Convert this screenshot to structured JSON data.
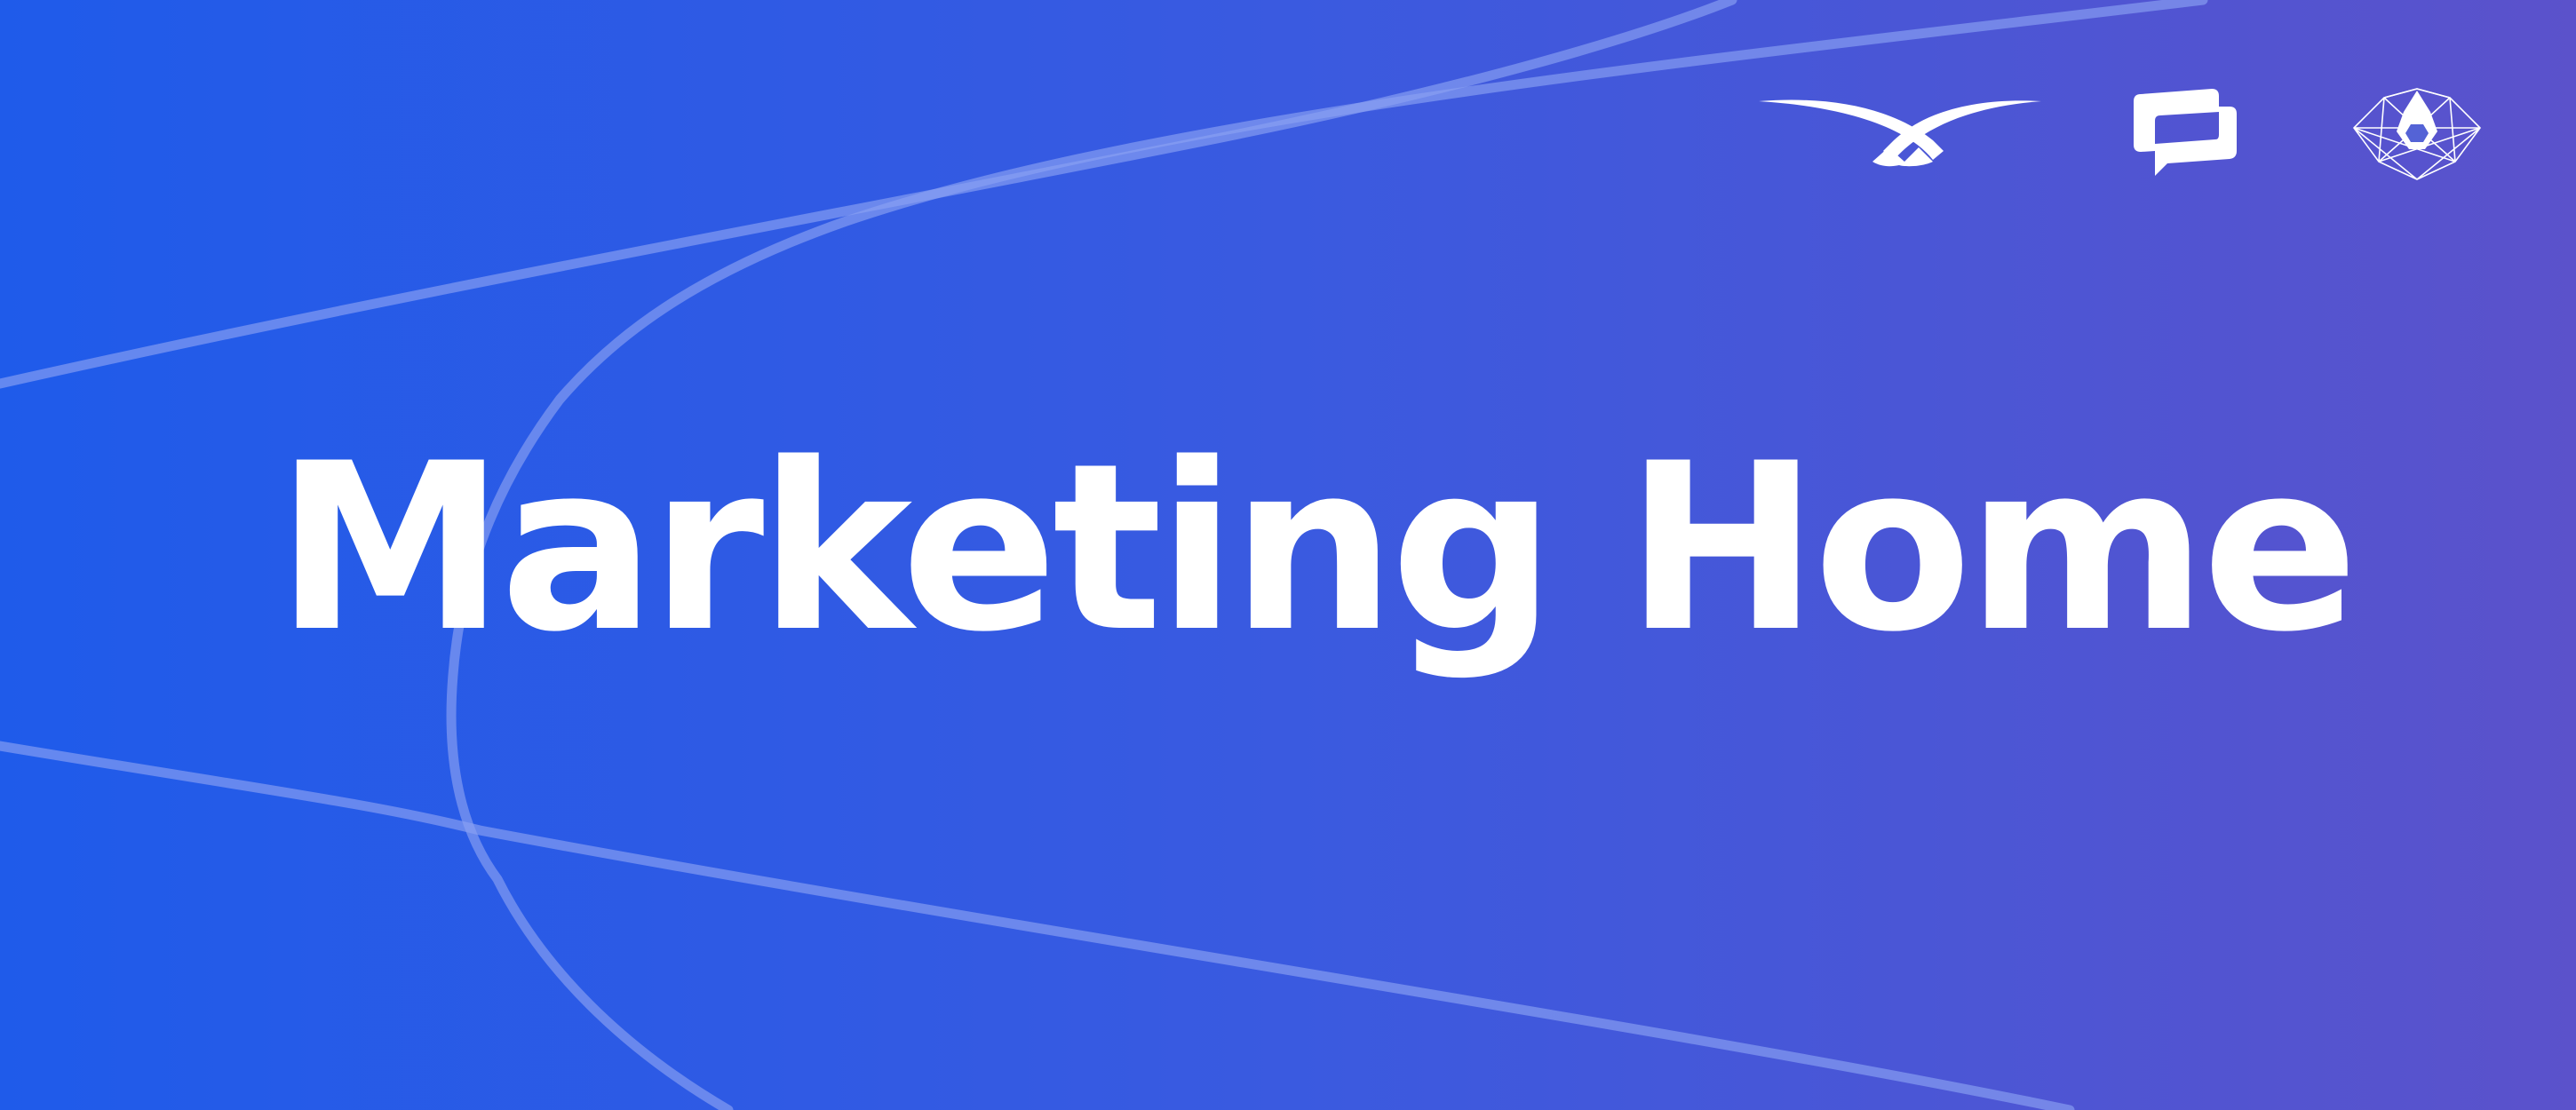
{
  "banner": {
    "title": "Marketing Home",
    "colors": {
      "gradient_start": "#1f5bea",
      "gradient_end": "#5b52cb",
      "text": "#ffffff",
      "line": "#8aa2f2"
    }
  },
  "logos": [
    {
      "icon": "wings-logo-icon"
    },
    {
      "icon": "chat-bubble-logo-icon"
    },
    {
      "icon": "geometric-gem-logo-icon"
    }
  ]
}
